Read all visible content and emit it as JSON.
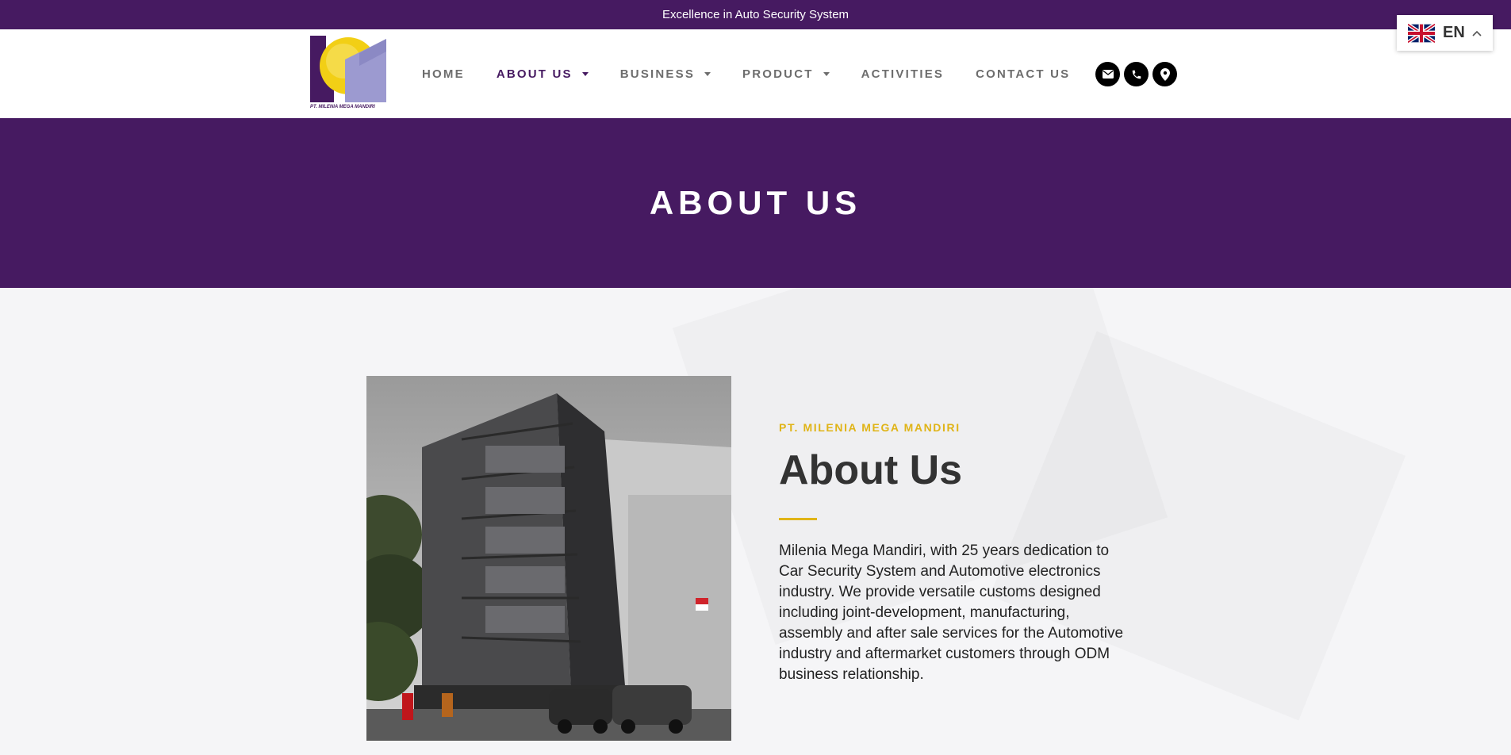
{
  "topbar": {
    "tagline": "Excellence in Auto Security System"
  },
  "logo": {
    "caption": "PT. MILENIA MEGA MANDIRI",
    "colors": {
      "purple": "#461a61",
      "lavender": "#9c9ad0",
      "sun": "#f2cf15"
    }
  },
  "nav": {
    "items": [
      {
        "label": "HOME",
        "dropdown": false,
        "active": false
      },
      {
        "label": "ABOUT US",
        "dropdown": true,
        "active": true
      },
      {
        "label": "BUSINESS",
        "dropdown": true,
        "active": false
      },
      {
        "label": "PRODUCT",
        "dropdown": true,
        "active": false
      },
      {
        "label": "ACTIVITIES",
        "dropdown": false,
        "active": false
      },
      {
        "label": "CONTACT US",
        "dropdown": false,
        "active": false
      }
    ]
  },
  "contact_icons": [
    "envelope-icon",
    "phone-icon",
    "map-pin-icon"
  ],
  "language": {
    "code": "EN",
    "flag": "uk-flag-icon"
  },
  "hero": {
    "title": "ABOUT US"
  },
  "about": {
    "kicker": "PT. MILENIA MEGA MANDIRI",
    "title": "About Us",
    "body": "Milenia Mega Mandiri, with 25 years dedication to Car Security System and Automotive electronics industry. We provide versatile customs designed including joint-development, manufacturing, assembly and after sale services for the Automotive industry and aftermarket customers through ODM business relationship."
  },
  "colors": {
    "brand_purple": "#461a61",
    "accent_yellow": "#e0b417",
    "nav_text": "#6d6d6d"
  }
}
